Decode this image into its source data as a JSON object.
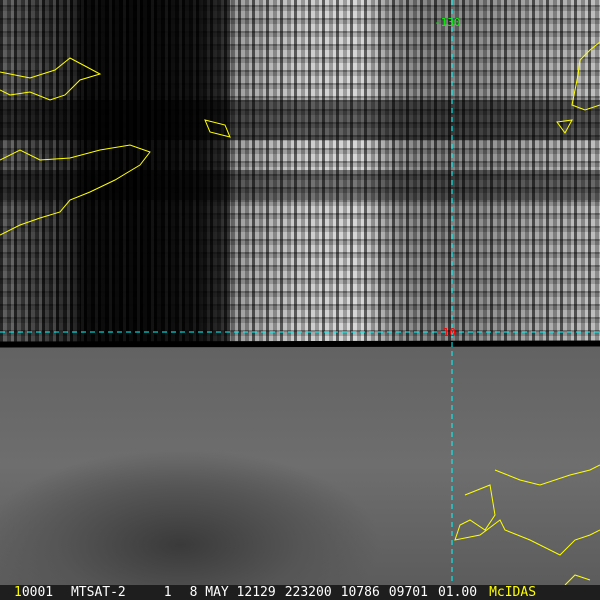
{
  "image": {
    "type": "satellite-image",
    "overlay_color": "#ffff00",
    "grid_color": "#00ffff"
  },
  "grid_labels": {
    "longitude": {
      "text": "-130",
      "color": "#00ff00"
    },
    "latitude": {
      "text": "-10",
      "color": "#ff0000"
    }
  },
  "status_bar": {
    "frame": "1",
    "image_number": "0001",
    "satellite": "MTSAT-2",
    "band": "1",
    "date": "8 MAY 12129",
    "time": "223200",
    "line": "10786",
    "element": "09701",
    "magnification": "01.00",
    "brand": "McIDAS"
  }
}
